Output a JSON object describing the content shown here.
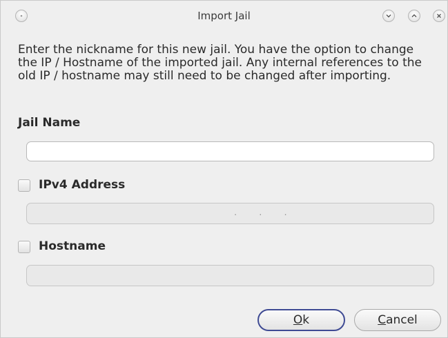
{
  "window": {
    "title": "Import Jail"
  },
  "description": "Enter the nickname for this new jail. You have the option to change the IP / Hostname of the imported jail. Any internal references to the old IP / hostname may still need to be changed after importing.",
  "jail_name": {
    "label": "Jail Name",
    "value": ""
  },
  "ipv4": {
    "label": "IPv4 Address",
    "checked": false,
    "placeholder": ". . ."
  },
  "hostname": {
    "label": "Hostname",
    "checked": false,
    "value": ""
  },
  "buttons": {
    "ok": {
      "mnemonic": "O",
      "rest": "k"
    },
    "cancel": {
      "mnemonic": "C",
      "rest": "ancel"
    }
  },
  "colors": {
    "window_bg": "#efefef",
    "default_button_border": "#3e4a93"
  },
  "icons": {
    "window_menu": "window-menu-icon",
    "minimize": "chevron-down-icon",
    "maximize": "chevron-up-icon",
    "close": "close-icon"
  }
}
